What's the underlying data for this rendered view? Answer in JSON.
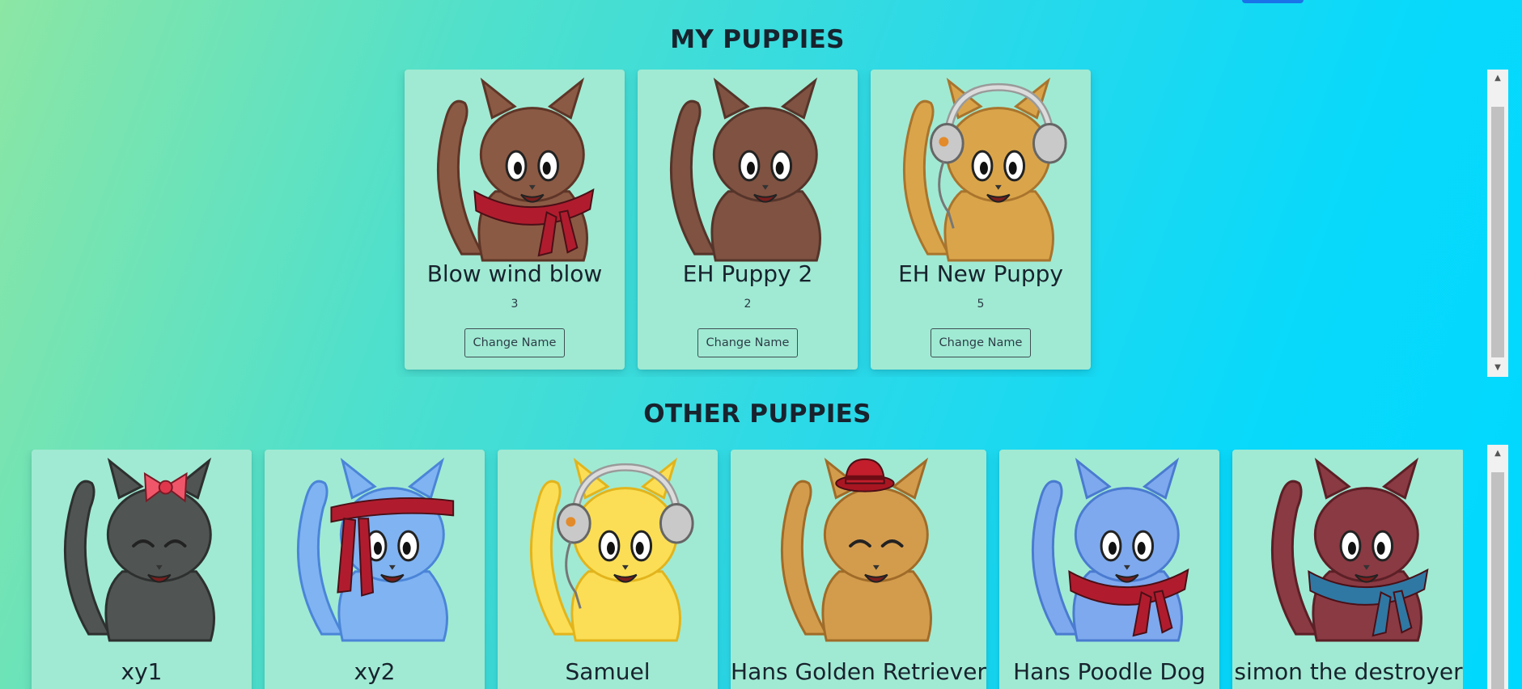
{
  "sections": {
    "my_title": "MY PUPPIES",
    "other_title": "OTHER PUPPIES"
  },
  "my_puppies": [
    {
      "name": "Blow wind blow",
      "count": "3",
      "button": "Change Name",
      "body": "#8b5a44",
      "outline": "#5e3527",
      "accessory": "scarf-red",
      "eyes": "open"
    },
    {
      "name": "EH Puppy 2",
      "count": "2",
      "button": "Change Name",
      "body": "#7f5242",
      "outline": "#55342a",
      "accessory": "none",
      "eyes": "open"
    },
    {
      "name": "EH New Puppy",
      "count": "5",
      "button": "Change Name",
      "body": "#daa54a",
      "outline": "#a9742d",
      "accessory": "headphones",
      "eyes": "open"
    }
  ],
  "other_puppies": [
    {
      "name": "xy1",
      "body": "#505553",
      "outline": "#2d302f",
      "accessory": "bow",
      "eyes": "closed"
    },
    {
      "name": "xy2",
      "body": "#80b3f2",
      "outline": "#4a85d8",
      "accessory": "headband-red",
      "eyes": "open"
    },
    {
      "name": "Samuel",
      "body": "#fbde55",
      "outline": "#e2b41c",
      "accessory": "headphones",
      "eyes": "open"
    },
    {
      "name": "Hans Golden Retriever",
      "body": "#d39c4d",
      "outline": "#a06b28",
      "accessory": "hat-red",
      "eyes": "closed"
    },
    {
      "name": "Hans Poodle Dog",
      "body": "#7ea9ee",
      "outline": "#4a7bd0",
      "accessory": "scarf-red",
      "eyes": "open"
    },
    {
      "name": "simon the destroyer",
      "body": "#8a3a43",
      "outline": "#5c1f26",
      "accessory": "scarf-blue",
      "eyes": "open"
    }
  ],
  "icons": {
    "scroll_up": "triangle-up-icon",
    "scroll_down": "triangle-down-icon"
  }
}
